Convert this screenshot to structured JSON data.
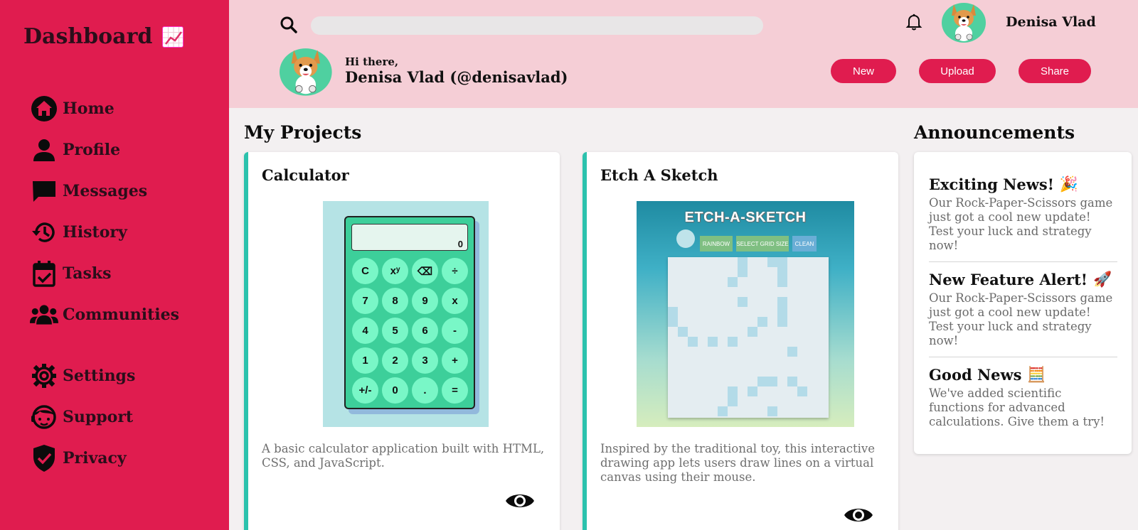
{
  "sidebar": {
    "brand": "Dashboard",
    "items": [
      {
        "label": "Home",
        "icon": "home-icon"
      },
      {
        "label": "Profile",
        "icon": "profile-icon"
      },
      {
        "label": "Messages",
        "icon": "messages-icon"
      },
      {
        "label": "History",
        "icon": "history-icon"
      },
      {
        "label": "Tasks",
        "icon": "tasks-icon"
      },
      {
        "label": "Communities",
        "icon": "communities-icon"
      }
    ],
    "items2": [
      {
        "label": "Settings",
        "icon": "gear-icon"
      },
      {
        "label": "Support",
        "icon": "support-icon"
      },
      {
        "label": "Privacy",
        "icon": "shield-icon"
      }
    ]
  },
  "header": {
    "search_placeholder": "",
    "username": "Denisa Vlad",
    "greeting": "Hi there,",
    "fullname": "Denisa Vlad (@denisavlad)",
    "buttons": {
      "new": "New",
      "upload": "Upload",
      "share": "Share"
    }
  },
  "projects": {
    "title": "My Projects",
    "items": [
      {
        "title": "Calculator",
        "description": "A basic calculator application built with HTML, CSS, and JavaScript.",
        "preview": {
          "display": "0",
          "keys": [
            "C",
            "xʸ",
            "⌫",
            "÷",
            "7",
            "8",
            "9",
            "x",
            "4",
            "5",
            "6",
            "-",
            "1",
            "2",
            "3",
            "+",
            "+/-",
            "0",
            ".",
            "="
          ]
        }
      },
      {
        "title": "Etch A Sketch",
        "description": "Inspired by the traditional toy, this interactive drawing app lets users draw lines on a virtual canvas using their mouse.",
        "preview": {
          "heading": "ETCH-A-SKETCH",
          "buttons": [
            "RAINBOW",
            "SELECT GRID SIZE",
            "CLEAN"
          ]
        }
      }
    ]
  },
  "announcements": {
    "title": "Announcements",
    "items": [
      {
        "title": "Exciting News!",
        "emoji": "🎉",
        "body": "Our Rock-Paper-Scissors game just got a cool new update! Test your luck and strategy now!"
      },
      {
        "title": "New Feature Alert!",
        "emoji": "🚀",
        "body": "Our Rock-Paper-Scissors game just got a cool new update! Test your luck and strategy now!"
      },
      {
        "title": "Good News",
        "emoji": "🧮",
        "body": "We've added scientific functions for advanced calculations. Give them a try!"
      }
    ]
  },
  "colors": {
    "accent": "#e01c4f",
    "header_bg": "#f5ced6",
    "card_border": "#2bc2ad",
    "page_bg": "#f3f0f1"
  }
}
